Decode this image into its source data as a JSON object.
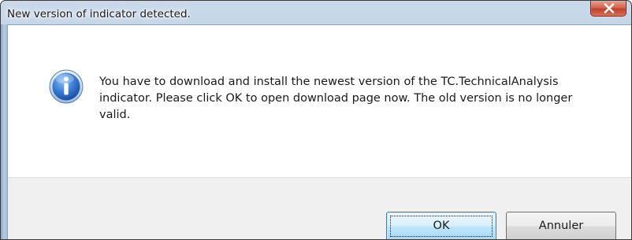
{
  "dialog": {
    "title": "New version of indicator detected.",
    "icon": "info-icon",
    "message": "You have to download and install the newest version of the TC.TechnicalAnalysis indicator. Please click OK to open download page now. The old version is no longer valid.",
    "ok_label": "OK",
    "cancel_label": "Annuler",
    "close_icon": "close-icon"
  },
  "colors": {
    "close_button": "#c0402a",
    "info_icon": "#2f6fc6",
    "default_button_border": "#3c7fb1"
  }
}
